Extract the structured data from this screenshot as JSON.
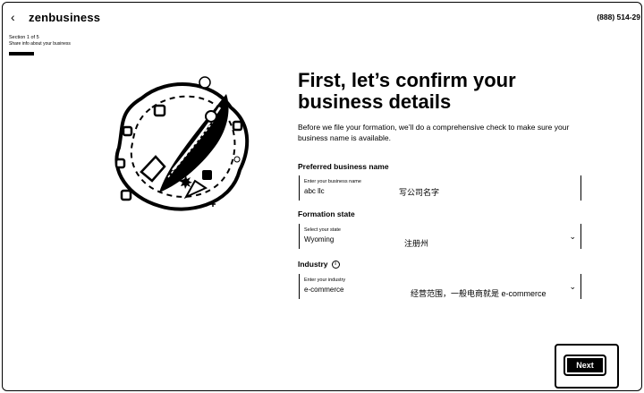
{
  "header": {
    "brand": "zenbusiness",
    "phone": "(888) 514-29",
    "section_label": "Section 1 of 5",
    "section_sub": "Share info about your business"
  },
  "progress": {
    "fraction": 0.2
  },
  "main": {
    "title_line1": "First, let’s confirm your",
    "title_line2": "business details",
    "description": "Before we file your formation, we’ll do a comprehensive check to make sure your business name is available."
  },
  "fields": {
    "business_name": {
      "label": "Preferred business name",
      "caption": "Enter your business name",
      "value": "abc llc",
      "note": "写公司名字"
    },
    "formation_state": {
      "label": "Formation state",
      "caption": "Select your state",
      "value": "Wyoming",
      "note": "注册州"
    },
    "industry": {
      "label": "Industry",
      "caption": "Enter your industry",
      "value": "e-commerce",
      "note": "经营范围，一般电商就是 e-commerce"
    }
  },
  "actions": {
    "next_label": "Next"
  }
}
